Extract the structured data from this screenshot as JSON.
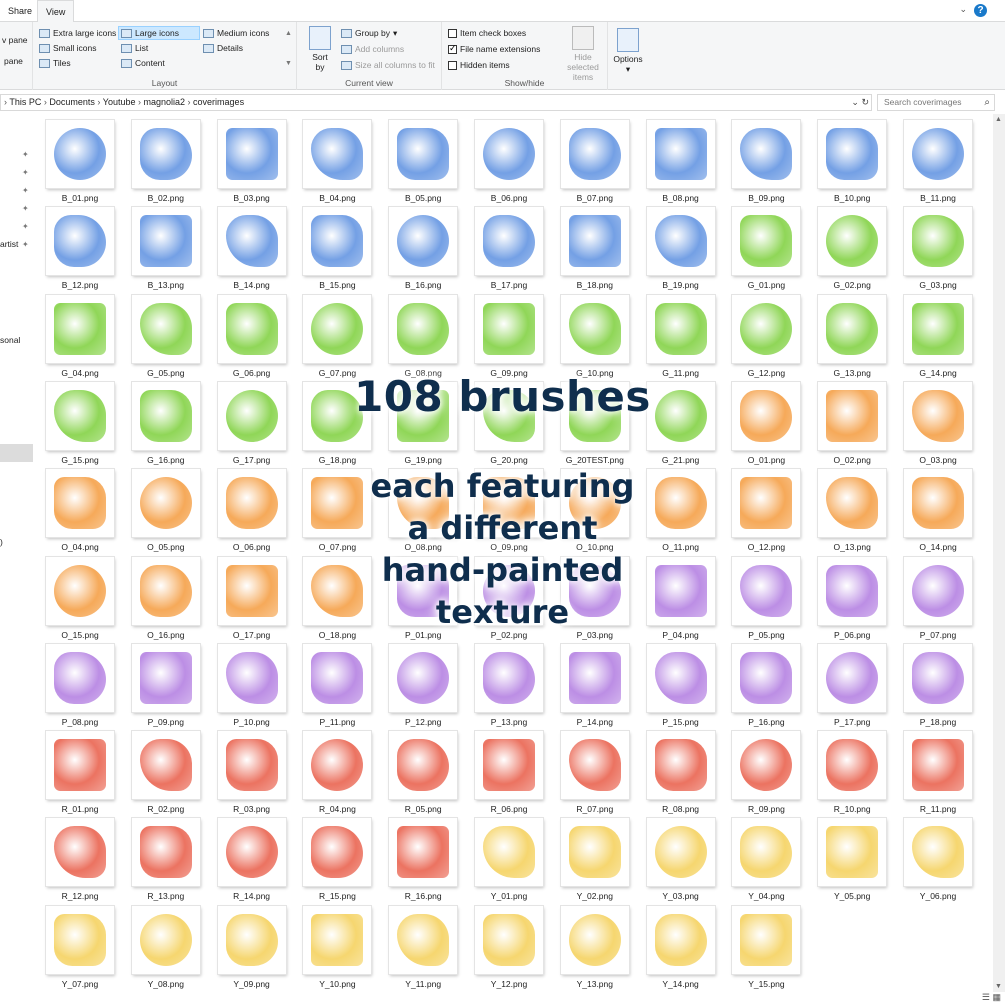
{
  "tabs": {
    "share": "Share",
    "view": "View"
  },
  "ribbon": {
    "layout": {
      "label": "Layout",
      "items": [
        "Extra large icons",
        "Large icons",
        "Medium icons",
        "Small icons",
        "List",
        "Details",
        "Tiles",
        "Content"
      ]
    },
    "panes": {
      "preview": "v pane",
      "details": "pane"
    },
    "current_view": {
      "label": "Current view",
      "sort": "Sort by",
      "group": "Group by",
      "add_columns": "Add columns",
      "size_columns": "Size all columns to fit"
    },
    "show_hide": {
      "label": "Show/hide",
      "item_checkboxes": "Item check boxes",
      "file_extensions": "File name extensions",
      "hidden_items": "Hidden items",
      "hide_selected": "Hide selected items"
    },
    "options": "Options"
  },
  "breadcrumb": [
    "This PC",
    "Documents",
    "Youtube",
    "magnolia2",
    "coverimages"
  ],
  "search": {
    "placeholder": "Search coverimages"
  },
  "nav": {
    "artist": "artist",
    "personal": "sonal",
    "other": ")"
  },
  "overlay": {
    "title": "108 brushes",
    "lines": [
      "each featuring",
      "a different",
      "hand-painted",
      "texture"
    ]
  },
  "colors": {
    "B": "#5b8fe0",
    "G": "#7ccf3a",
    "O": "#f49a3c",
    "P": "#b07ae0",
    "R": "#e85a45",
    "Y": "#f4cf56"
  },
  "files": [
    "B_01.png",
    "B_02.png",
    "B_03.png",
    "B_04.png",
    "B_05.png",
    "B_06.png",
    "B_07.png",
    "B_08.png",
    "B_09.png",
    "B_10.png",
    "B_11.png",
    "B_12.png",
    "B_13.png",
    "B_14.png",
    "B_15.png",
    "B_16.png",
    "B_17.png",
    "B_18.png",
    "B_19.png",
    "G_01.png",
    "G_02.png",
    "G_03.png",
    "G_04.png",
    "G_05.png",
    "G_06.png",
    "G_07.png",
    "G_08.png",
    "G_09.png",
    "G_10.png",
    "G_11.png",
    "G_12.png",
    "G_13.png",
    "G_14.png",
    "G_15.png",
    "G_16.png",
    "G_17.png",
    "G_18.png",
    "G_19.png",
    "G_20.png",
    "G_20TEST.png",
    "G_21.png",
    "O_01.png",
    "O_02.png",
    "O_03.png",
    "O_04.png",
    "O_05.png",
    "O_06.png",
    "O_07.png",
    "O_08.png",
    "O_09.png",
    "O_10.png",
    "O_11.png",
    "O_12.png",
    "O_13.png",
    "O_14.png",
    "O_15.png",
    "O_16.png",
    "O_17.png",
    "O_18.png",
    "P_01.png",
    "P_02.png",
    "P_03.png",
    "P_04.png",
    "P_05.png",
    "P_06.png",
    "P_07.png",
    "P_08.png",
    "P_09.png",
    "P_10.png",
    "P_11.png",
    "P_12.png",
    "P_13.png",
    "P_14.png",
    "P_15.png",
    "P_16.png",
    "P_17.png",
    "P_18.png",
    "R_01.png",
    "R_02.png",
    "R_03.png",
    "R_04.png",
    "R_05.png",
    "R_06.png",
    "R_07.png",
    "R_08.png",
    "R_09.png",
    "R_10.png",
    "R_11.png",
    "R_12.png",
    "R_13.png",
    "R_14.png",
    "R_15.png",
    "R_16.png",
    "Y_01.png",
    "Y_02.png",
    "Y_03.png",
    "Y_04.png",
    "Y_05.png",
    "Y_06.png",
    "Y_07.png",
    "Y_08.png",
    "Y_09.png",
    "Y_10.png",
    "Y_11.png",
    "Y_12.png",
    "Y_13.png",
    "Y_14.png",
    "Y_15.png"
  ]
}
